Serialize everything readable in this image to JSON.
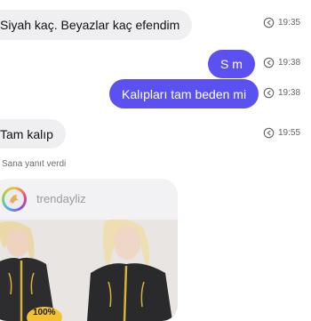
{
  "messages": {
    "m1": {
      "text": "Siyah kaç. Beyazlar kaç efendim",
      "time": "19:35"
    },
    "m2": {
      "text": "S m",
      "time": "19:38"
    },
    "m3": {
      "text": "Kalıpları tam beden mi",
      "time": "19:38"
    },
    "m4": {
      "text": "Tam kalıp",
      "time": "19:55"
    }
  },
  "reply_note": "Sana yanıt verdi",
  "story_card": {
    "username": "trendayliz",
    "badge_text": "100%"
  },
  "colors": {
    "outgoing_bubble": "#5b51f0",
    "incoming_bubble": "#efeff1"
  }
}
